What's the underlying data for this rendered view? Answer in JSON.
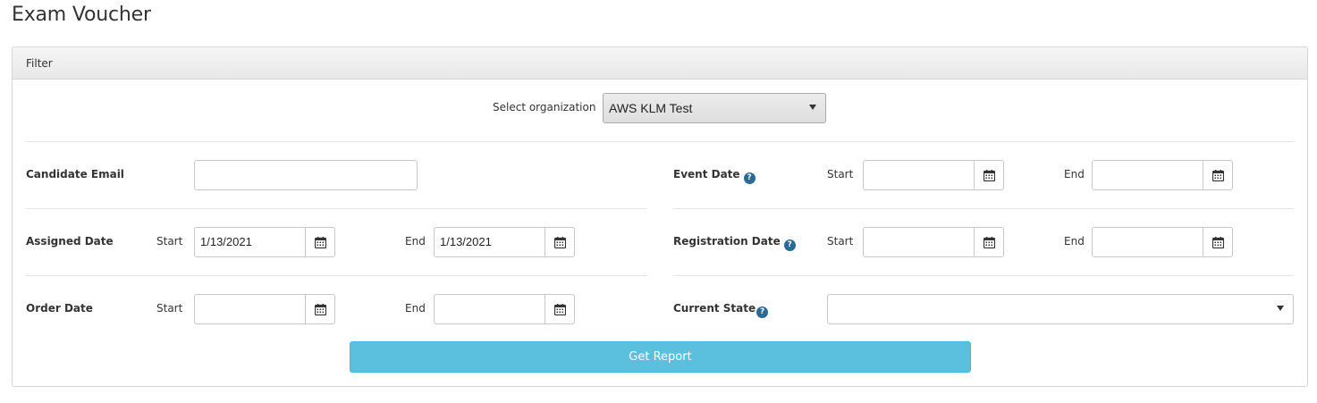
{
  "page": {
    "title": "Exam Voucher"
  },
  "filter": {
    "heading": "Filter",
    "organization": {
      "label": "Select organization",
      "selected": "AWS KLM Test"
    },
    "candidate_email": {
      "label": "Candidate Email",
      "value": ""
    },
    "assigned_date": {
      "label": "Assigned Date",
      "start_label": "Start",
      "start_value": "1/13/2021",
      "end_label": "End",
      "end_value": "1/13/2021"
    },
    "order_date": {
      "label": "Order Date",
      "start_label": "Start",
      "start_value": "",
      "end_label": "End",
      "end_value": ""
    },
    "event_date": {
      "label": "Event Date",
      "start_label": "Start",
      "start_value": "",
      "end_label": "End",
      "end_value": ""
    },
    "registration_date": {
      "label": "Registration Date",
      "start_label": "Start",
      "start_value": "",
      "end_label": "End",
      "end_value": ""
    },
    "current_state": {
      "label": "Current State",
      "selected": ""
    },
    "help_glyph": "?",
    "submit_label": "Get Report"
  },
  "colors": {
    "button": "#5bc0de",
    "help_icon": "#2b6a96"
  },
  "icons": {
    "calendar": "calendar-icon",
    "help": "help-icon",
    "dropdown": "chevron-down-icon"
  }
}
